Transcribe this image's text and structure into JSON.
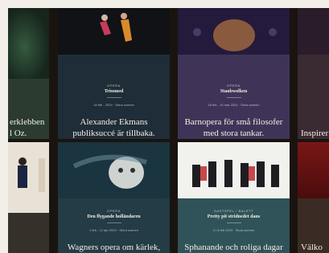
{
  "cards": [
    {
      "head": "erklebben\nl Oz.",
      "cat": "",
      "sub": "",
      "date": ""
    },
    {
      "cat": "OPERA",
      "sub": "Trissmed",
      "date": "18 feb - 2024 · Stora scenen",
      "head": "Alexander Ekmans\npubliksuccé är tillbaka."
    },
    {
      "cat": "OPERA",
      "sub": "Staubwolken",
      "date": "18 feb - 10 mar 2024 · Stora scenen",
      "head": "Barnopera för små filosofer\nmed stora tankar."
    },
    {
      "head": "Inspirer",
      "cat": "",
      "sub": "",
      "date": ""
    },
    {
      "head": "",
      "cat": "",
      "sub": "",
      "date": ""
    },
    {
      "cat": "OPERA",
      "sub": "Den flygande holländaren",
      "date": "1 feb - 12 apr 2024 · Stora scenen",
      "head": "Wagners opera om kärlek,"
    },
    {
      "cat": "GASTSPEL / BALETT",
      "sub": "Pretty pit stridnedet dans",
      "date": "3 / 8 feb 2024 · Stora scenen",
      "head": "Sphanande och roliga dagar"
    },
    {
      "head": "Välko",
      "cat": "",
      "sub": "",
      "date": ""
    }
  ]
}
